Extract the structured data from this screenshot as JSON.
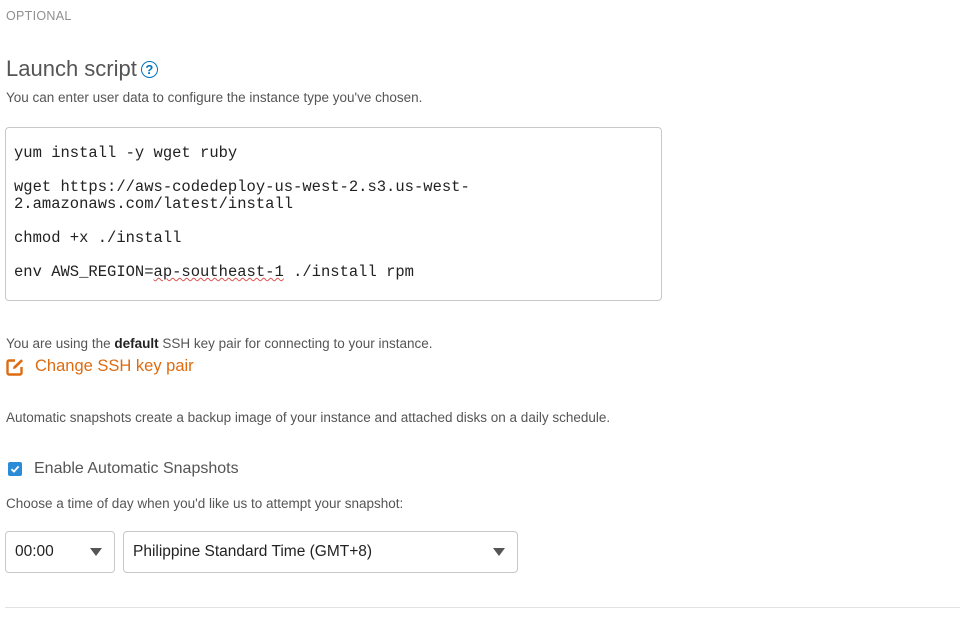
{
  "section": {
    "optional_label": "OPTIONAL"
  },
  "launch_script": {
    "heading": "Launch script",
    "help_icon_glyph": "?",
    "description": "You can enter user data to configure the instance type you've chosen.",
    "lines": [
      "yum install -y wget ruby",
      "wget https://aws-codedeploy-us-west-2.s3.us-west-",
      "2.amazonaws.com/latest/install",
      "chmod +x ./install",
      "env AWS_REGION=",
      "ap-southeast-1",
      " ./install rpm"
    ]
  },
  "ssh": {
    "text_before": "You are using the ",
    "text_bold": "default",
    "text_after": " SSH key pair for connecting to your instance.",
    "change_link": "Change SSH key pair",
    "link_color": "#dd6b10",
    "icon": "edit-icon"
  },
  "snapshots": {
    "description": "Automatic snapshots create a backup image of your instance and attached disks on a daily schedule.",
    "checkbox_label": "Enable Automatic Snapshots",
    "checkbox_checked": true,
    "checkbox_color": "#2a8cd7",
    "choose_text": "Choose a time of day when you'd like us to attempt your snapshot:",
    "time_value": "00:00",
    "timezone_value": "Philippine Standard Time (GMT+8)"
  },
  "colors": {
    "help_icon": "#0073bb",
    "muted_text": "#555555"
  }
}
